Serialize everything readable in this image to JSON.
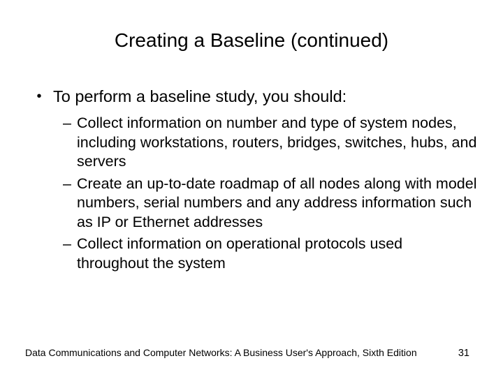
{
  "title": "Creating a Baseline (continued)",
  "main_item": {
    "text": "To perform a baseline study, you should:"
  },
  "sub_items": [
    {
      "text": "Collect information on number and type of system nodes, including workstations, routers, bridges, switches, hubs, and servers"
    },
    {
      "text": "Create an up-to-date roadmap of all nodes along with model numbers, serial numbers and any address information such as IP or Ethernet addresses"
    },
    {
      "text": "Collect information on operational protocols used throughout the system"
    }
  ],
  "footer": {
    "source": "Data Communications and Computer Networks: A Business User's Approach, Sixth Edition",
    "page": "31"
  },
  "marks": {
    "bullet": "•",
    "dash": "–"
  }
}
